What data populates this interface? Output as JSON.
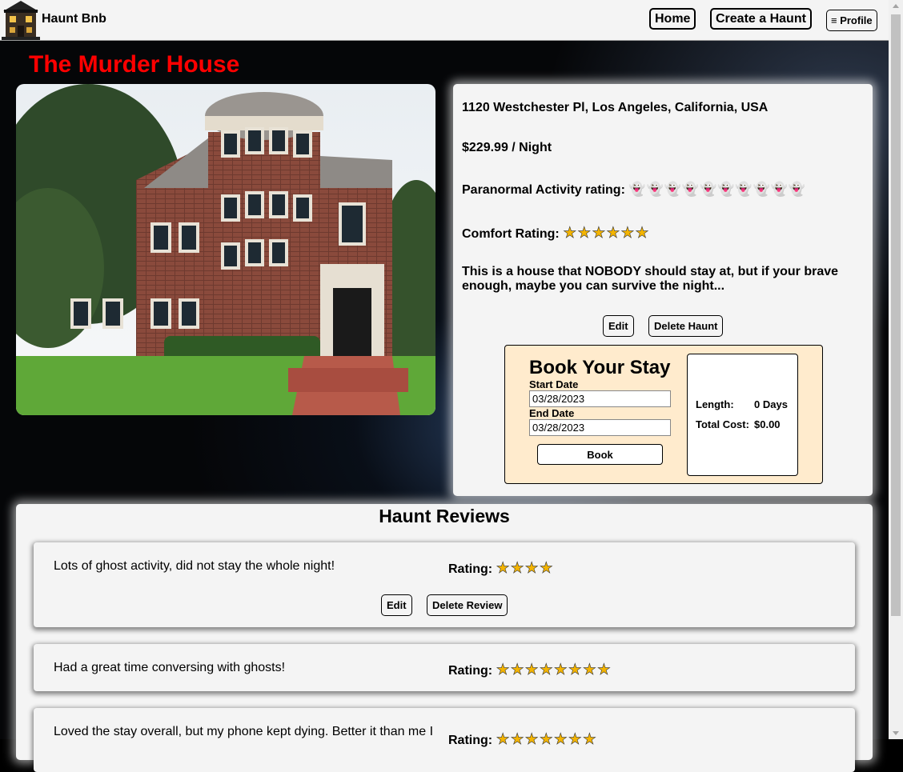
{
  "nav": {
    "brand": "Haunt Bnb",
    "home_label": "Home",
    "create_label": "Create a Haunt",
    "profile_label": "≡ Profile"
  },
  "listing": {
    "title": "The Murder House",
    "address": "1120 Westchester Pl, Los Angeles, California, USA",
    "price": "$229.99 / Night",
    "paranormal_label": "Paranormal Activity rating:",
    "paranormal_rating": 10,
    "comfort_label": "Comfort Rating:",
    "comfort_rating": 6,
    "description": "This is a house that NOBODY should stay at, but if your brave enough, maybe you can survive the night...",
    "edit_label": "Edit",
    "delete_label": "Delete Haunt"
  },
  "booking": {
    "title": "Book Your Stay",
    "start_label": "Start Date",
    "start_value": "03/28/2023",
    "end_label": "End Date",
    "end_value": "03/28/2023",
    "book_label": "Book",
    "length_label": "Length:",
    "length_value": "0 Days",
    "cost_label": "Total Cost:",
    "cost_value": "$0.00"
  },
  "reviews": {
    "title": "Haunt Reviews",
    "rating_label": "Rating:",
    "edit_label": "Edit",
    "delete_label": "Delete Review",
    "items": [
      {
        "text": "Lots of ghost activity, did not stay the whole night!",
        "rating": 4
      },
      {
        "text": "Had a great time conversing with ghosts!",
        "rating": 8
      },
      {
        "text": "Loved the stay overall, but my phone kept dying. Better it than me I",
        "rating": 7
      }
    ]
  },
  "colors": {
    "title_red": "#ff0000",
    "booking_bg": "#ffebcd",
    "panel_bg": "#f4f4f4",
    "star": "#f4b400"
  },
  "icons": {
    "star": "star-icon",
    "ghost": "ghost-icon",
    "logo": "haunted-house-logo"
  }
}
